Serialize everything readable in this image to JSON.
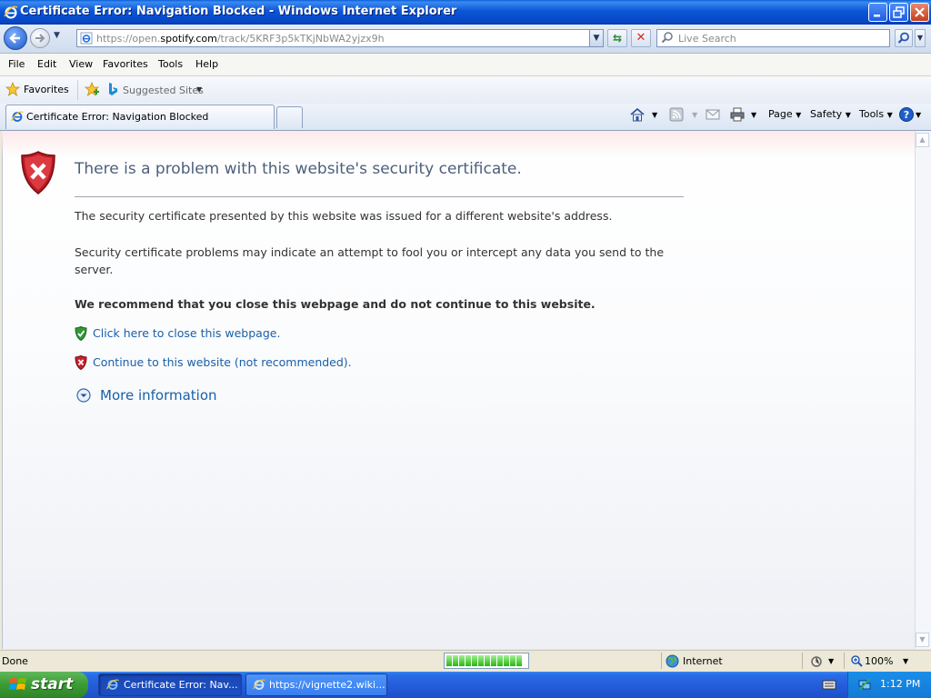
{
  "window": {
    "title": "Certificate Error: Navigation Blocked - Windows Internet Explorer"
  },
  "address": {
    "url_prefix": "https://open.",
    "url_host": "spotify.com",
    "url_suffix": "/track/5KRF3p5kTKjNbWA2yjzx9h"
  },
  "search": {
    "placeholder": "Live Search"
  },
  "menu": {
    "items": [
      "File",
      "Edit",
      "View",
      "Favorites",
      "Tools",
      "Help"
    ]
  },
  "favorites_bar": {
    "favorites_label": "Favorites",
    "suggested_label": "Suggested Sites"
  },
  "tabs": {
    "active_label": "Certificate Error: Navigation Blocked"
  },
  "command_bar": {
    "page_label": "Page",
    "safety_label": "Safety",
    "tools_label": "Tools"
  },
  "error_page": {
    "title": "There is a problem with this website's security certificate.",
    "para1": "The security certificate presented by this website was issued for a different website's address.",
    "para2": "Security certificate problems may indicate an attempt to fool you or intercept any data you send to the server.",
    "recommend": "We recommend that you close this webpage and do not continue to this website.",
    "close_link": "Click here to close this webpage.",
    "continue_link": "Continue to this website (not recommended).",
    "more_info": "More information"
  },
  "status_bar": {
    "status": "Done",
    "zone": "Internet",
    "zoom": "100%",
    "progress_blocks": 12
  },
  "taskbar": {
    "start_label": "start",
    "items": [
      {
        "label": "Certificate Error: Nav..."
      },
      {
        "label": "https://vignette2.wiki..."
      }
    ],
    "clock": "1:12 PM"
  },
  "colors": {
    "titlebar": "#0b56d6",
    "link": "#1a5fa8",
    "error_title": "#4d5f7b",
    "shield_red": "#c8202a",
    "shield_green": "#2f9a36"
  }
}
